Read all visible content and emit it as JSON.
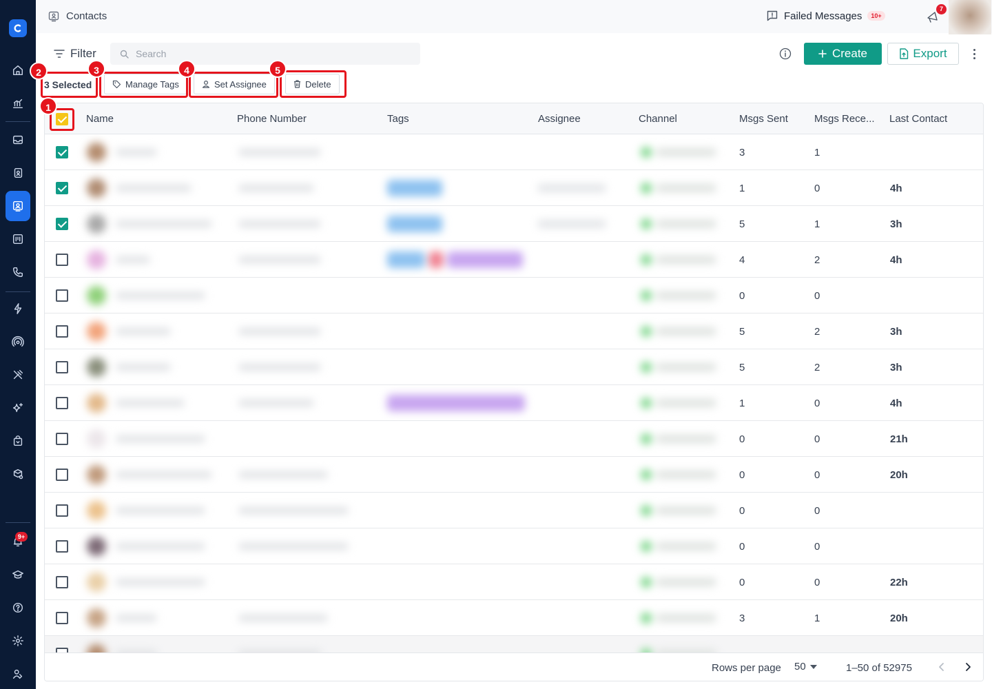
{
  "header": {
    "page_title": "Contacts",
    "failed_messages_label": "Failed Messages",
    "failed_messages_badge": "10+",
    "announcements_badge": "7"
  },
  "nav": {
    "notifications_badge": "9+",
    "active_item": "contacts"
  },
  "toolbar": {
    "filter_label": "Filter",
    "search_placeholder": "Search",
    "create_label": "Create",
    "export_label": "Export"
  },
  "bulk": {
    "selected_label": "3 Selected",
    "manage_tags_label": "Manage Tags",
    "set_assignee_label": "Set Assignee",
    "delete_label": "Delete"
  },
  "annotations": [
    "1",
    "2",
    "3",
    "4",
    "5"
  ],
  "table": {
    "columns": [
      "Name",
      "Phone Number",
      "Tags",
      "Assignee",
      "Channel",
      "Msgs Sent",
      "Msgs Rece...",
      "Last Contact"
    ],
    "rows": [
      {
        "checked": true,
        "msgs_sent": "3",
        "msgs_received": "1",
        "last_contact": ""
      },
      {
        "checked": true,
        "msgs_sent": "1",
        "msgs_received": "0",
        "last_contact": "4h"
      },
      {
        "checked": true,
        "msgs_sent": "5",
        "msgs_received": "1",
        "last_contact": "3h"
      },
      {
        "checked": false,
        "msgs_sent": "4",
        "msgs_received": "2",
        "last_contact": "4h"
      },
      {
        "checked": false,
        "msgs_sent": "0",
        "msgs_received": "0",
        "last_contact": ""
      },
      {
        "checked": false,
        "msgs_sent": "5",
        "msgs_received": "2",
        "last_contact": "3h"
      },
      {
        "checked": false,
        "msgs_sent": "5",
        "msgs_received": "2",
        "last_contact": "3h"
      },
      {
        "checked": false,
        "msgs_sent": "1",
        "msgs_received": "0",
        "last_contact": "4h"
      },
      {
        "checked": false,
        "msgs_sent": "0",
        "msgs_received": "0",
        "last_contact": "21h"
      },
      {
        "checked": false,
        "msgs_sent": "0",
        "msgs_received": "0",
        "last_contact": "20h"
      },
      {
        "checked": false,
        "msgs_sent": "0",
        "msgs_received": "0",
        "last_contact": ""
      },
      {
        "checked": false,
        "msgs_sent": "0",
        "msgs_received": "0",
        "last_contact": ""
      },
      {
        "checked": false,
        "msgs_sent": "0",
        "msgs_received": "0",
        "last_contact": "22h"
      },
      {
        "checked": false,
        "msgs_sent": "3",
        "msgs_received": "1",
        "last_contact": "20h"
      }
    ]
  },
  "pagination": {
    "rows_per_page_label": "Rows per page",
    "rows_per_page_value": "50",
    "range_label": "1–50 of 52975"
  },
  "colors": {
    "accent": "#109b87",
    "nav_bg": "#0b1b35",
    "nav_active": "#1f6feb",
    "annotation_red": "#e5141d",
    "header_checkbox": "#f5c518"
  },
  "icons": [
    "home-icon",
    "analytics-icon",
    "inbox-icon",
    "contacts-book-icon",
    "contacts-icon",
    "broadcast-icon",
    "phone-icon",
    "automation-icon",
    "integrations-icon",
    "tools-icon",
    "ai-sparkle-icon",
    "commerce-icon",
    "workspace-icon",
    "bell-icon",
    "academy-icon",
    "help-icon",
    "settings-icon",
    "team-icon"
  ]
}
